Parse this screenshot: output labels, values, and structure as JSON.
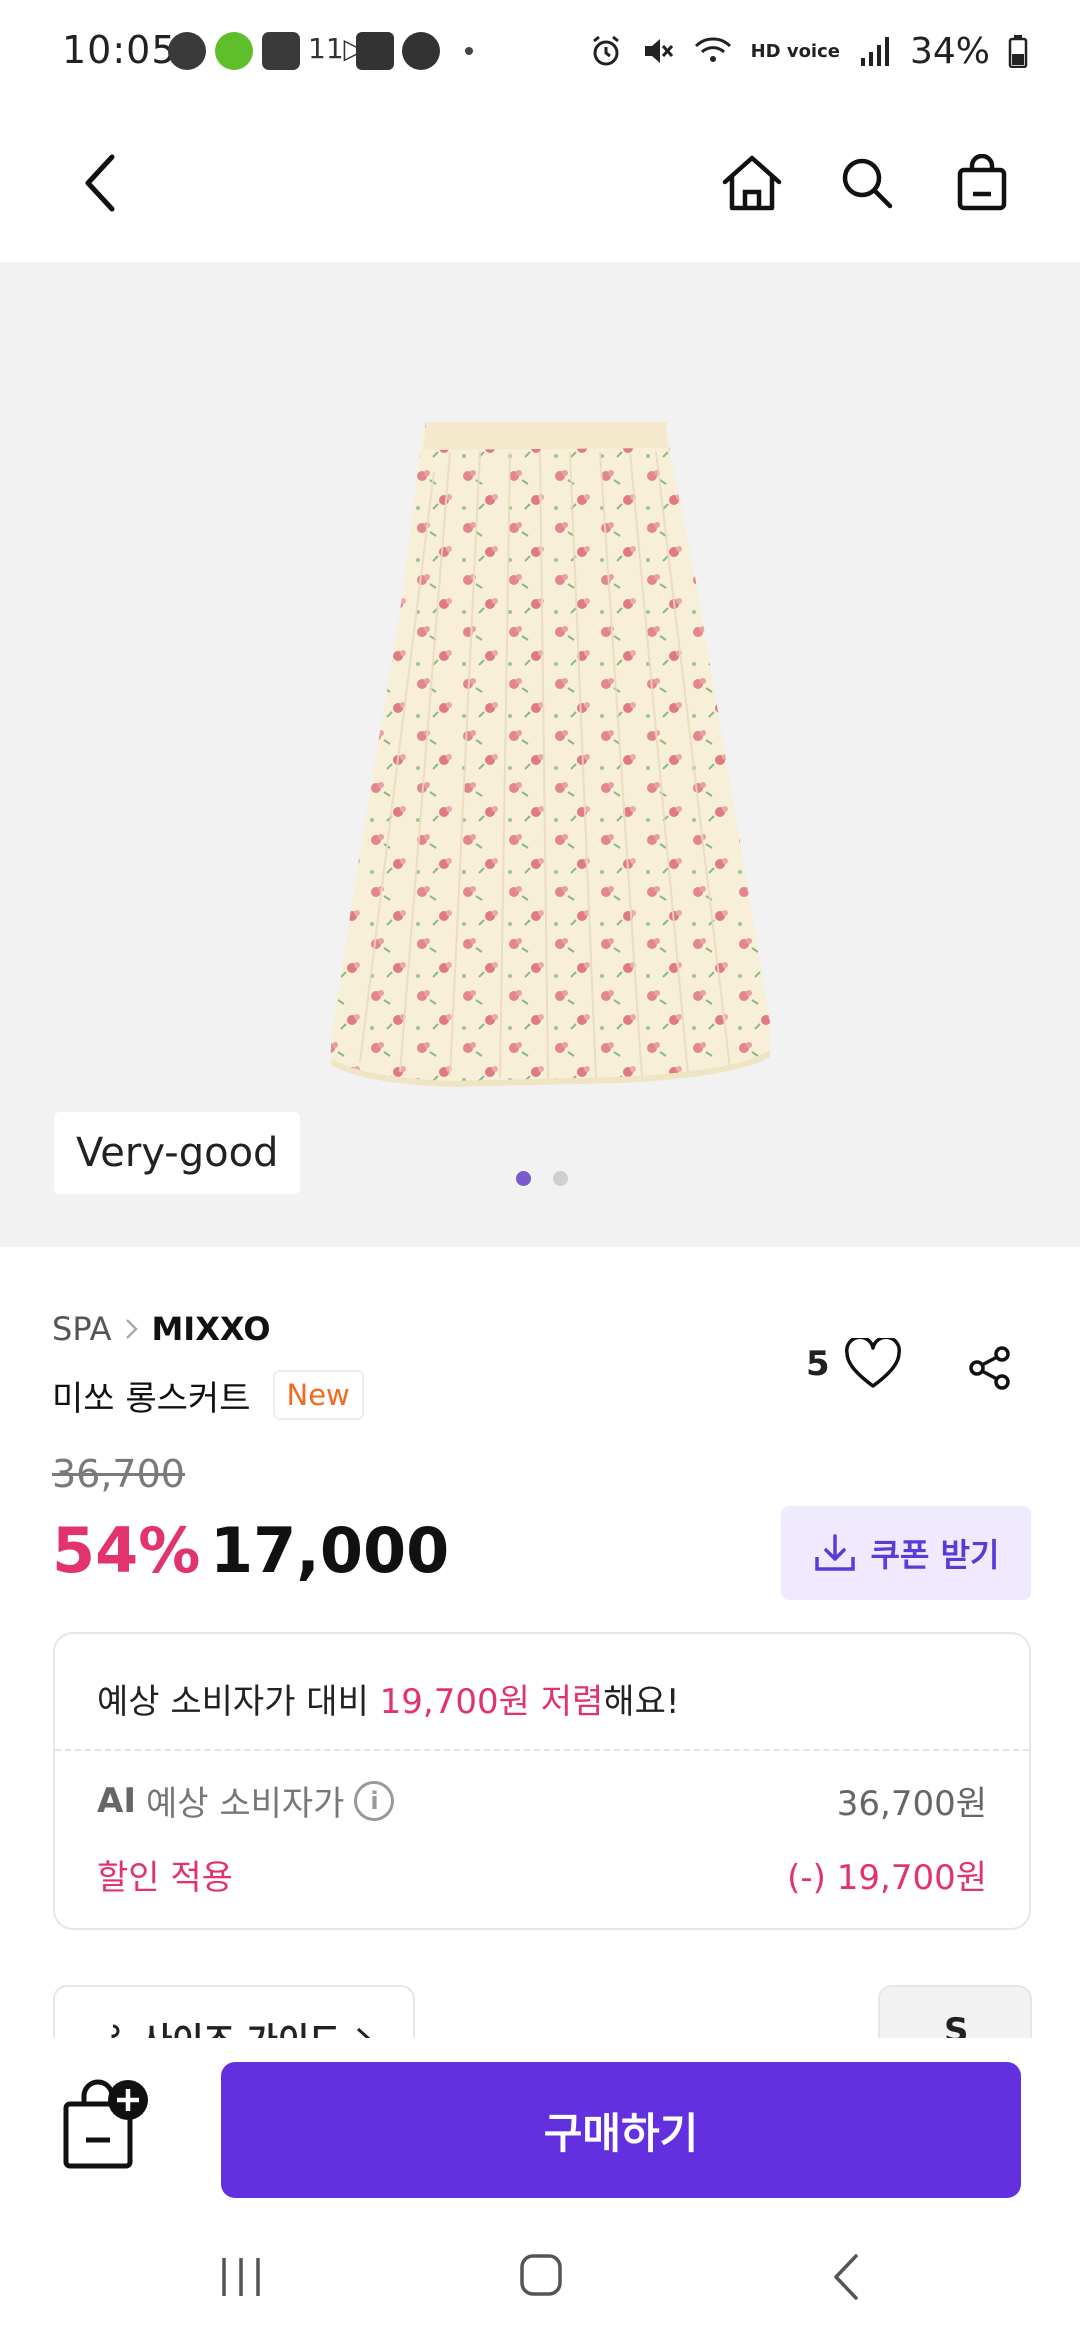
{
  "status_bar": {
    "time": "10:05",
    "battery": "34%",
    "app_icons": [
      "talk-icon",
      "naver-icon",
      "emart-icon",
      "11st-icon",
      "shopping-bag-icon",
      "c-icon"
    ],
    "hd_voice": "HD voice"
  },
  "header": {
    "icons": [
      "back-icon",
      "home-icon",
      "search-icon",
      "shopping-bag-icon"
    ]
  },
  "gallery": {
    "grade_badge": "Very-good",
    "page_count": 2,
    "active_page": 1
  },
  "product": {
    "category": "SPA",
    "brand": "MIXXO",
    "name": "미쏘 롱스커트",
    "badge": "New",
    "like_count": "5",
    "original_price": "36,700",
    "discount_rate": "54%",
    "sale_price": "17,000",
    "coupon_label": "쿠폰 받기"
  },
  "savings": {
    "prefix": "예상 소비자가 대비 ",
    "amount": "19,700원 저렴",
    "suffix": "해요!",
    "ai_label": "AI",
    "retail_label": "예상 소비자가",
    "retail_value": "36,700원",
    "discount_label": "할인 적용",
    "discount_value": "(-) 19,700원"
  },
  "size": {
    "guide_label": "사이즈 가이드",
    "selected": "S"
  },
  "bottom": {
    "buy_label": "구매하기"
  },
  "colors": {
    "accent": "#6330e0",
    "pink": "#e2336f",
    "coupon_bg": "#efeafd",
    "new_orange": "#f06a1f"
  }
}
